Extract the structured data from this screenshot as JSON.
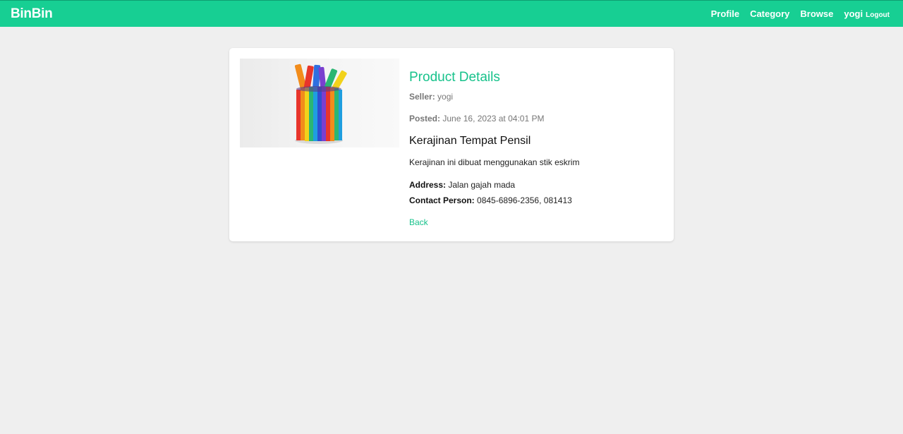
{
  "navbar": {
    "brand": "BinBin",
    "links": [
      "Profile",
      "Category",
      "Browse"
    ],
    "user": "yogi",
    "logout": "Logout",
    "color": "#17cf93"
  },
  "product": {
    "section_title": "Product Details",
    "seller_label": "Seller:",
    "seller": "yogi",
    "posted_label": "Posted:",
    "posted": "June 16, 2023 at 04:01 PM",
    "name": "Kerajinan Tempat Pensil",
    "description": "Kerajinan ini dibuat menggunakan stik eskrim",
    "address_label": "Address:",
    "address": "Jalan gajah mada",
    "contact_label": "Contact Person:",
    "contact": "0845-6896-2356, 081413",
    "back": "Back",
    "accent_color": "#17c28b"
  }
}
